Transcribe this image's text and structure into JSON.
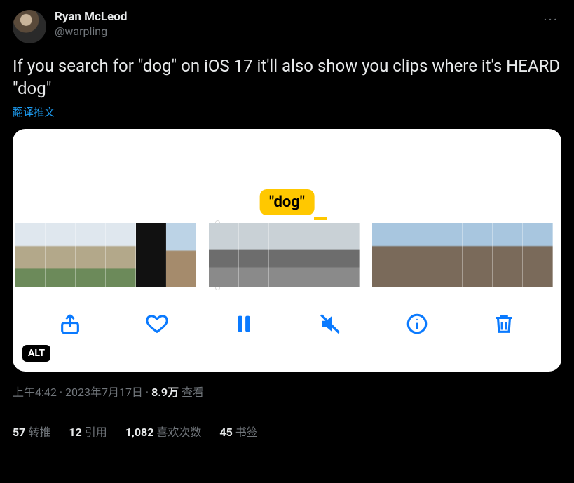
{
  "author": {
    "display_name": "Ryan McLeod",
    "handle": "@warpling"
  },
  "tweet_text": "If you search for \"dog\" on iOS 17 it'll also show you clips where it's HEARD \"dog\"",
  "translate_label": "翻译推文",
  "media": {
    "search_term": "\"dog\"",
    "alt_badge": "ALT",
    "controls": [
      "share",
      "like",
      "pause",
      "mute",
      "info",
      "delete"
    ]
  },
  "meta": {
    "time": "上午4:42",
    "date": "2023年7月17日",
    "views_count": "8.9万",
    "views_label": "查看"
  },
  "stats": {
    "retweets_count": "57",
    "retweets_label": "转推",
    "quotes_count": "12",
    "quotes_label": "引用",
    "likes_count": "1,082",
    "likes_label": "喜欢次数",
    "bookmarks_count": "45",
    "bookmarks_label": "书签"
  },
  "more_dots": "···"
}
